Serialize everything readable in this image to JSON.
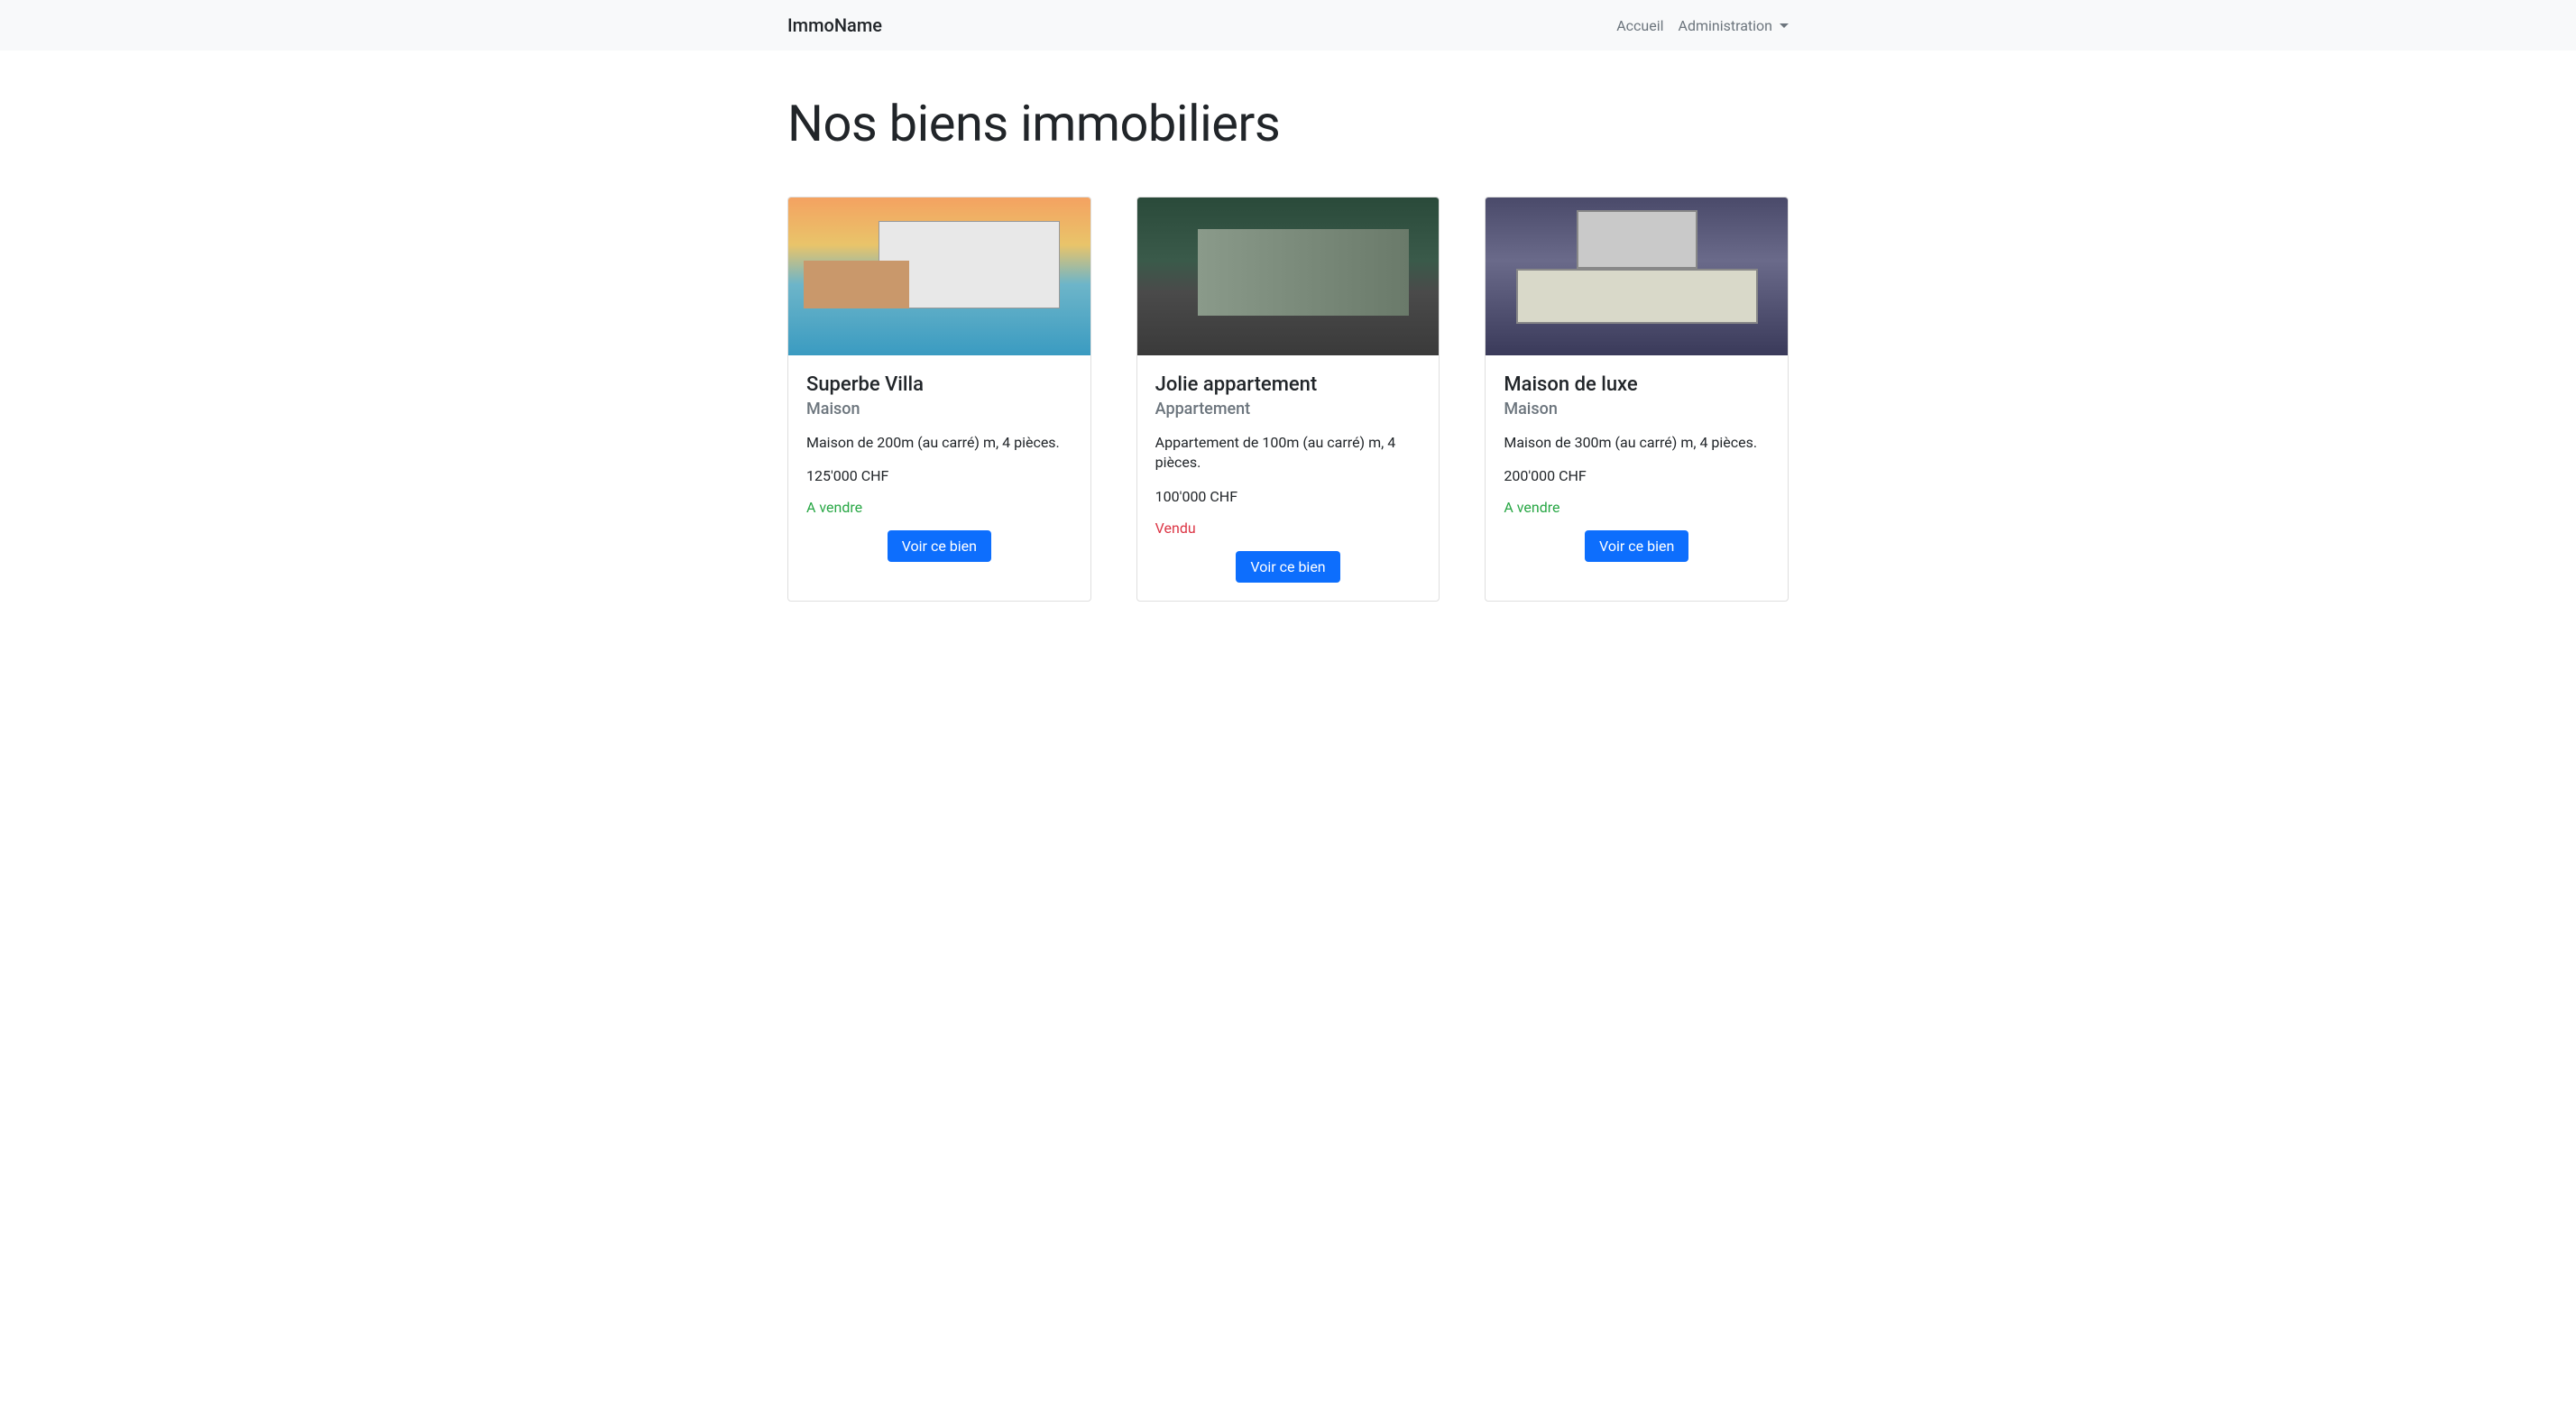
{
  "nav": {
    "brand": "ImmoName",
    "links": {
      "home": "Accueil",
      "admin": "Administration"
    }
  },
  "page": {
    "title": "Nos biens immobiliers"
  },
  "properties": [
    {
      "title": "Superbe Villa",
      "subtitle": "Maison",
      "description": "Maison de 200m (au carré) m, 4 pièces.",
      "price": "125'000 CHF",
      "status": "A vendre",
      "statusType": "available",
      "button": "Voir ce bien",
      "imageClass": "img-villa"
    },
    {
      "title": "Jolie appartement",
      "subtitle": "Appartement",
      "description": "Appartement de 100m (au carré) m, 4 pièces.",
      "price": "100'000 CHF",
      "status": "Vendu",
      "statusType": "sold",
      "button": "Voir ce bien",
      "imageClass": "img-apartment"
    },
    {
      "title": "Maison de luxe",
      "subtitle": "Maison",
      "description": "Maison de 300m (au carré) m, 4 pièces.",
      "price": "200'000 CHF",
      "status": "A vendre",
      "statusType": "available",
      "button": "Voir ce bien",
      "imageClass": "img-luxe"
    }
  ]
}
